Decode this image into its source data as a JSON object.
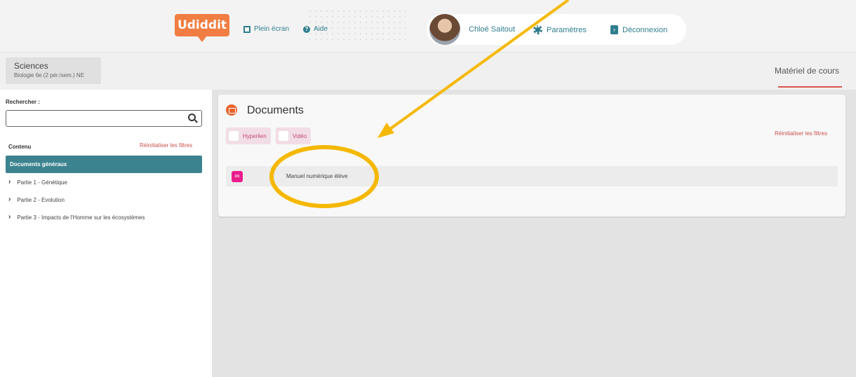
{
  "header": {
    "logo_text": "Udiddit",
    "fullscreen_label": "Plein écran",
    "help_label": "Aide",
    "user_name": "Chloé Saitout",
    "settings_label": "Paramètres",
    "logout_label": "Déconnexion"
  },
  "course": {
    "title": "Sciences",
    "subtitle": "Biologie 6e (2 pér./sem.) NE",
    "tab_label": "Matériel de cours"
  },
  "sidebar": {
    "search_label": "Rechercher :",
    "search_value": "",
    "content_label": "Contenu",
    "reset_filters": "Réinitialiser les filtres",
    "active_item": "Documents généraux",
    "items": [
      {
        "label": "Partie 1 - Génétique"
      },
      {
        "label": "Partie 2 - Evolution"
      },
      {
        "label": "Partie 3 - Impacts de l'Homme sur les écosystèmes"
      }
    ]
  },
  "main": {
    "section_title": "Documents",
    "filters": [
      {
        "label": "Hyperlien"
      },
      {
        "label": "Vidéo"
      }
    ],
    "reset_filters": "Réinitialiser les filtres",
    "documents": [
      {
        "label": "Manuel numérique élève",
        "type_icon": "link-icon"
      }
    ]
  },
  "colors": {
    "brand": "#f07d42",
    "accent": "#2f7e8e",
    "active_nav": "#3c8390",
    "reset_link": "#c9524e",
    "link_badge": "#e91e8c",
    "annotation": "#f5b800"
  }
}
